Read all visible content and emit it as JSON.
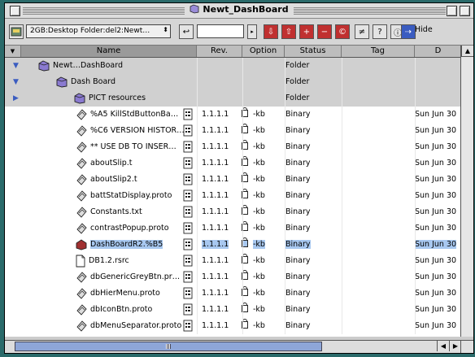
{
  "window": {
    "title": "Newt_DashBoard"
  },
  "toolbar": {
    "path_popup": "2GB:Desktop Folder:del2:Newt…",
    "filter_value": "",
    "hide_label": "Hide"
  },
  "columns": {
    "name": "Name",
    "rev": "Rev.",
    "option": "Option",
    "status": "Status",
    "tag": "Tag",
    "date": "D"
  },
  "rows": [
    {
      "name": "Newt…DashBoard",
      "type": "folder",
      "status": "Folder",
      "expanded": true,
      "level": 0
    },
    {
      "name": "Dash Board",
      "type": "folder",
      "status": "Folder",
      "expanded": true,
      "level": 1
    },
    {
      "name": "PICT resources",
      "type": "folder",
      "status": "Folder",
      "expanded": false,
      "level": 2
    },
    {
      "name": "%A5 KillStdButtonBa…",
      "rev": "1.1.1.1",
      "option": "-kb",
      "status": "Binary",
      "date": "Sun Jun 30"
    },
    {
      "name": "%C6 VERSION HISTOR…",
      "rev": "1.1.1.1",
      "option": "-kb",
      "status": "Binary",
      "date": "Sun Jun 30"
    },
    {
      "name": "** USE DB TO INSER…",
      "rev": "1.1.1.1",
      "option": "-kb",
      "status": "Binary",
      "date": "Sun Jun 30"
    },
    {
      "name": "aboutSlip.t",
      "rev": "1.1.1.1",
      "option": "-kb",
      "status": "Binary",
      "date": "Sun Jun 30"
    },
    {
      "name": "aboutSlip2.t",
      "rev": "1.1.1.1",
      "option": "-kb",
      "status": "Binary",
      "date": "Sun Jun 30"
    },
    {
      "name": "battStatDisplay.proto",
      "rev": "1.1.1.1",
      "option": "-kb",
      "status": "Binary",
      "date": "Sun Jun 30"
    },
    {
      "name": "Constants.txt",
      "rev": "1.1.1.1",
      "option": "-kb",
      "status": "Binary",
      "date": "Sun Jun 30"
    },
    {
      "name": "contrastPopup.proto",
      "rev": "1.1.1.1",
      "option": "-kb",
      "status": "Binary",
      "date": "Sun Jun 30"
    },
    {
      "name": "DashBoardR2.%B5",
      "rev": "1.1.1.1",
      "option": "-kb",
      "status": "Binary",
      "date": "Sun Jun 30",
      "selected": true
    },
    {
      "name": "DB1.2.rsrc",
      "rev": "1.1.1.1",
      "option": "-kb",
      "status": "Binary",
      "date": "Sun Jun 30",
      "plain": true
    },
    {
      "name": "dbGenericGreyBtn.pr…",
      "rev": "1.1.1.1",
      "option": "-kb",
      "status": "Binary",
      "date": "Sun Jun 30"
    },
    {
      "name": "dbHierMenu.proto",
      "rev": "1.1.1.1",
      "option": "-kb",
      "status": "Binary",
      "date": "Sun Jun 30"
    },
    {
      "name": "dbIconBtn.proto",
      "rev": "1.1.1.1",
      "option": "-kb",
      "status": "Binary",
      "date": "Sun Jun 30"
    },
    {
      "name": "dbMenuSeparator.proto",
      "rev": "1.1.1.1",
      "option": "-kb",
      "status": "Binary",
      "date": "Sun Jun 30"
    }
  ]
}
